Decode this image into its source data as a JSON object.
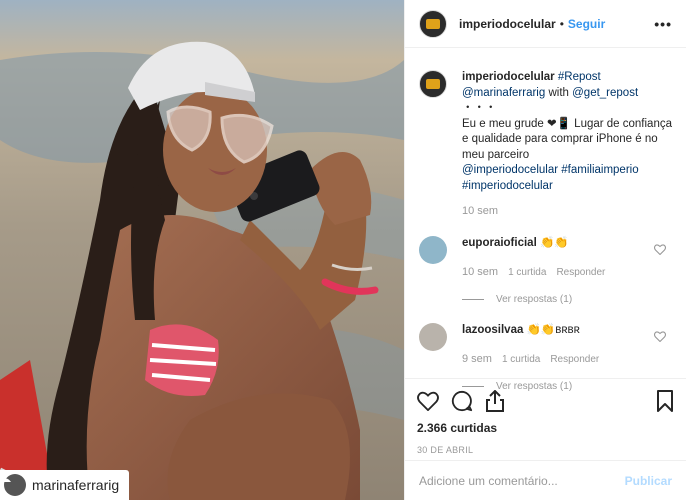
{
  "header": {
    "username": "imperiodocelular",
    "separator": "•",
    "follow_label": "Seguir",
    "more_label": "•••"
  },
  "photo": {
    "repost_username": "marinaferrarig",
    "description_colors": {
      "sand": "#b9ad97",
      "water": "#6e8da3",
      "skin": "#8a5a43",
      "hair": "#2a1e18",
      "cap": "#e9e9ea",
      "bikini": "#e0566b"
    }
  },
  "caption": {
    "username": "imperiodocelular",
    "tag_repost": "#Repost",
    "mention_author": "@marinaferrarig",
    "with_text": "with",
    "mention_tool": "@get_repost",
    "dots": "・・・",
    "text": "Eu e meu grude ❤📱 Lugar de confiança e qualidade para comprar iPhone é no meu parceiro",
    "mention_store": "@imperiodocelular",
    "tag_family": "#familiaimperio",
    "tag_store": "#imperiodocelular",
    "time": "10 sem"
  },
  "comments": [
    {
      "username": "euporaioficial",
      "text": "👏👏",
      "time": "10 sem",
      "likes": "1 curtida",
      "reply": "Responder",
      "view_replies": "Ver respostas (1)",
      "avatar_color": "#8fb6c9"
    },
    {
      "username": "lazoosilvaa",
      "text": "👏👏ʙʀʙʀ",
      "time": "9 sem",
      "likes": "1 curtida",
      "reply": "Responder",
      "view_replies": "Ver respostas (1)",
      "avatar_color": "#b9b3ab"
    }
  ],
  "actions": {
    "likes": "2.366 curtidas",
    "date": "30 DE ABRIL"
  },
  "add_comment": {
    "placeholder": "Adicione um comentário...",
    "publish_label": "Publicar"
  }
}
